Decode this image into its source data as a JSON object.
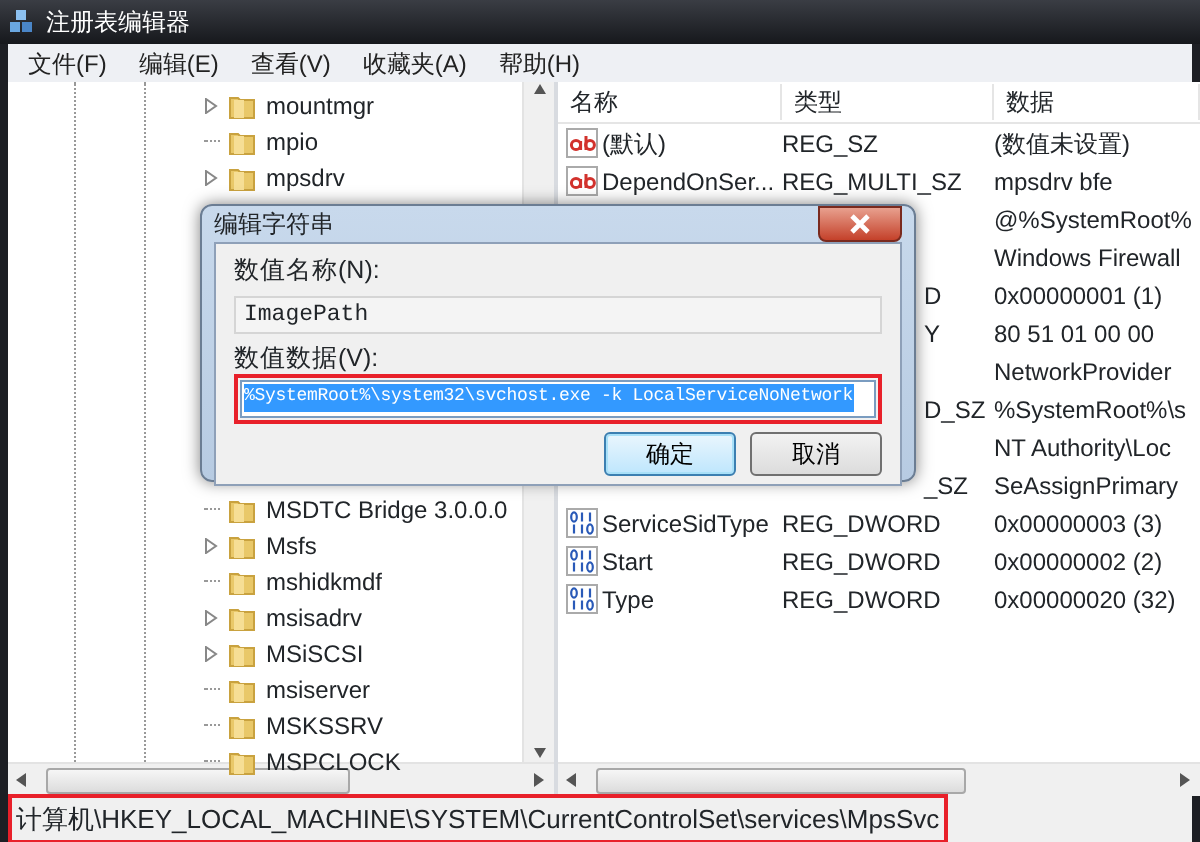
{
  "window": {
    "title": "注册表编辑器"
  },
  "menu": [
    "文件(F)",
    "编辑(E)",
    "查看(V)",
    "收藏夹(A)",
    "帮助(H)"
  ],
  "tree": {
    "items_top": [
      {
        "label": "mountmgr",
        "has_children": true
      },
      {
        "label": "mpio",
        "has_children": false
      },
      {
        "label": "mpsdrv",
        "has_children": true
      }
    ],
    "items_bottom": [
      {
        "label": "MSDTC Bridge 3.0.0.0",
        "has_children": false
      },
      {
        "label": "Msfs",
        "has_children": true
      },
      {
        "label": "mshidkmdf",
        "has_children": false
      },
      {
        "label": "msisadrv",
        "has_children": true
      },
      {
        "label": "MSiSCSI",
        "has_children": true
      },
      {
        "label": "msiserver",
        "has_children": false
      },
      {
        "label": "MSKSSRV",
        "has_children": false
      },
      {
        "label": "MSPCLOCK",
        "has_children": false
      }
    ]
  },
  "values": {
    "columns": [
      "名称",
      "类型",
      "数据"
    ],
    "rows": [
      {
        "kind": "string",
        "name": "(默认)",
        "type": "REG_SZ",
        "data": "(数值未设置)"
      },
      {
        "kind": "string",
        "name": "DependOnSer...",
        "type": "REG_MULTI_SZ",
        "data": "mpsdrv bfe"
      },
      {
        "kind": "covered",
        "data": "@%SystemRoot%"
      },
      {
        "kind": "covered",
        "data": "Windows Firewall"
      },
      {
        "kind": "covered",
        "type": "D",
        "data": "0x00000001 (1)"
      },
      {
        "kind": "covered",
        "type": "Y",
        "data": "80 51 01 00 00"
      },
      {
        "kind": "covered",
        "data": "NetworkProvider"
      },
      {
        "kind": "covered",
        "type": "D_SZ",
        "data": "%SystemRoot%\\s"
      },
      {
        "kind": "covered",
        "data": "NT Authority\\Loc"
      },
      {
        "kind": "covered",
        "type": "_SZ",
        "data": "SeAssignPrimary"
      },
      {
        "kind": "binary",
        "name": "ServiceSidType",
        "type": "REG_DWORD",
        "data": "0x00000003 (3)"
      },
      {
        "kind": "binary",
        "name": "Start",
        "type": "REG_DWORD",
        "data": "0x00000002 (2)"
      },
      {
        "kind": "binary",
        "name": "Type",
        "type": "REG_DWORD",
        "data": "0x00000020 (32)"
      }
    ]
  },
  "status_bar": {
    "path": "计算机\\HKEY_LOCAL_MACHINE\\SYSTEM\\CurrentControlSet\\services\\MpsSvc",
    "highlighted": true
  },
  "dialog": {
    "title": "编辑字符串",
    "name_label": "数值名称(N):",
    "name_value": "ImagePath",
    "data_label": "数值数据(V):",
    "data_value": "%SystemRoot%\\system32\\svchost.exe -k LocalServiceNoNetwork",
    "data_highlighted": true,
    "buttons": [
      {
        "label": "确定",
        "default": true
      },
      {
        "label": "取消",
        "default": false
      }
    ]
  }
}
